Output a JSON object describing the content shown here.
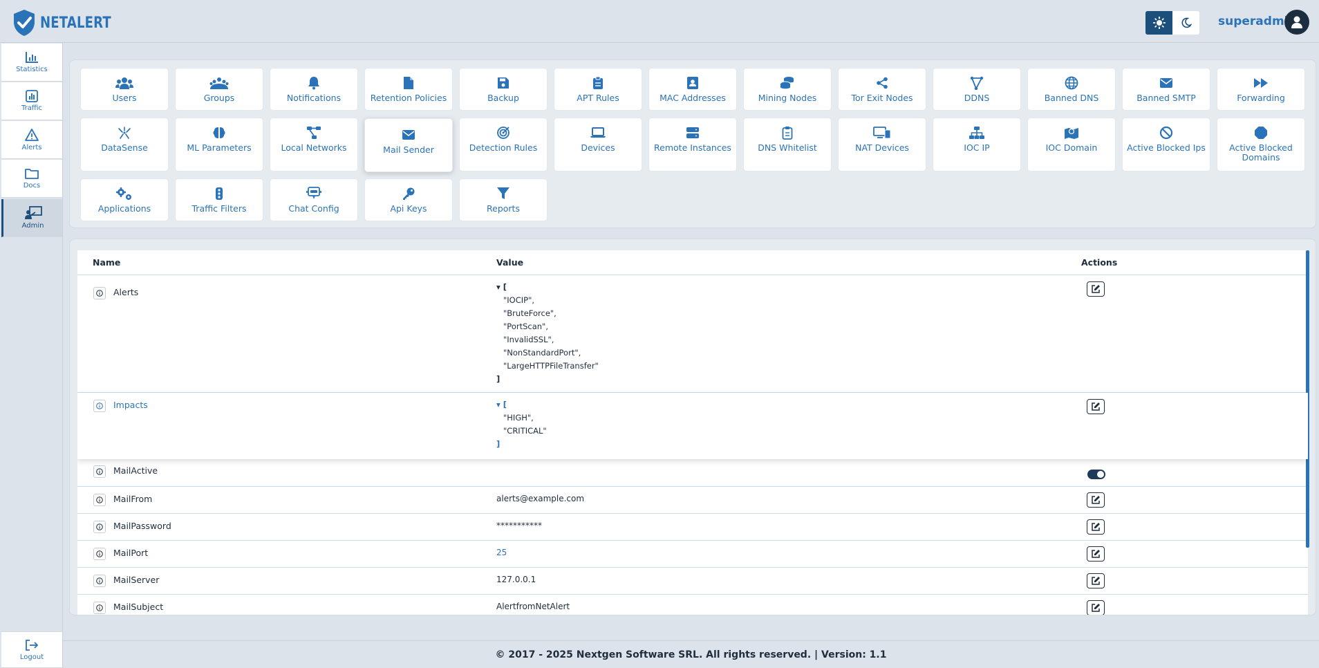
{
  "app": {
    "name": "NETALERT"
  },
  "header": {
    "username": "superadmin",
    "theme_light_icon": "sun-icon",
    "theme_dark_icon": "moon-icon"
  },
  "sidebar": {
    "items": [
      {
        "label": "Statistics",
        "icon": "bar-chart-icon"
      },
      {
        "label": "Traffic",
        "icon": "chart-square-icon"
      },
      {
        "label": "Alerts",
        "icon": "warning-triangle-icon"
      },
      {
        "label": "Docs",
        "icon": "folder-icon"
      },
      {
        "label": "Admin",
        "icon": "admin-presentation-icon",
        "active": true
      }
    ],
    "logout": "Logout"
  },
  "admin_menu": [
    {
      "label": "Users",
      "icon": "users-icon"
    },
    {
      "label": "Groups",
      "icon": "groups-icon"
    },
    {
      "label": "Notifications",
      "icon": "bell-icon"
    },
    {
      "label": "Retention Policies",
      "icon": "file-icon"
    },
    {
      "label": "Backup",
      "icon": "save-icon"
    },
    {
      "label": "APT Rules",
      "icon": "clipboard-icon"
    },
    {
      "label": "MAC Addresses",
      "icon": "address-book-icon"
    },
    {
      "label": "Mining Nodes",
      "icon": "coins-icon"
    },
    {
      "label": "Tor Exit Nodes",
      "icon": "share-icon"
    },
    {
      "label": "DDNS",
      "icon": "bezier-icon"
    },
    {
      "label": "Banned DNS",
      "icon": "globe-icon"
    },
    {
      "label": "Banned SMTP",
      "icon": "envelope-icon"
    },
    {
      "label": "Forwarding",
      "icon": "forward-icon"
    },
    {
      "label": "DataSense",
      "icon": "burst-icon"
    },
    {
      "label": "ML Parameters",
      "icon": "brain-icon"
    },
    {
      "label": "Local Networks",
      "icon": "network-icon"
    },
    {
      "label": "Mail Sender",
      "icon": "envelope-icon",
      "selected": true
    },
    {
      "label": "Detection Rules",
      "icon": "target-icon"
    },
    {
      "label": "Devices",
      "icon": "laptop-icon"
    },
    {
      "label": "Remote Instances",
      "icon": "server-icon"
    },
    {
      "label": "DNS Whitelist",
      "icon": "clipboard-check-icon"
    },
    {
      "label": "NAT Devices",
      "icon": "devices-icon"
    },
    {
      "label": "IOC IP",
      "icon": "sitemap-icon"
    },
    {
      "label": "IOC Domain",
      "icon": "map-marker-icon"
    },
    {
      "label": "Active Blocked Ips",
      "icon": "ban-icon"
    },
    {
      "label": "Active Blocked Domains",
      "icon": "octagon-icon"
    },
    {
      "label": "Applications",
      "icon": "gears-icon"
    },
    {
      "label": "Traffic Filters",
      "icon": "traffic-light-icon"
    },
    {
      "label": "Chat Config",
      "icon": "chat-icon"
    },
    {
      "label": "Api Keys",
      "icon": "key-icon"
    },
    {
      "label": "Reports",
      "icon": "filter-icon"
    }
  ],
  "table": {
    "headers": {
      "name": "Name",
      "value": "Value",
      "actions": "Actions"
    },
    "rows": [
      {
        "name": "Alerts",
        "type": "list",
        "open": "▾ [",
        "items": [
          "\"IOCIP\",",
          "\"BruteForce\",",
          "\"PortScan\",",
          "\"InvalidSSL\",",
          "\"NonStandardPort\",",
          "\"LargeHTTPFileTransfer\""
        ],
        "close": "]"
      },
      {
        "name": "Impacts",
        "type": "list",
        "open": "▾ [",
        "items": [
          "\"HIGH\",",
          "\"CRITICAL\""
        ],
        "close": "]"
      },
      {
        "name": "MailActive",
        "type": "toggle",
        "value": "",
        "enabled": true
      },
      {
        "name": "MailFrom",
        "type": "text",
        "value": "alerts@example.com"
      },
      {
        "name": "MailPassword",
        "type": "text",
        "value": "***********"
      },
      {
        "name": "MailPort",
        "type": "number",
        "value": "25"
      },
      {
        "name": "MailServer",
        "type": "text",
        "value": "127.0.0.1"
      },
      {
        "name": "MailSubject",
        "type": "text",
        "value": "AlertfromNetAlert"
      }
    ]
  },
  "footer": {
    "text": "© 2017 - 2025 Nextgen Software SRL. All rights reserved. | Version: 1.1"
  },
  "colors": {
    "accent": "#2a73b8",
    "dark": "#1d4f7c",
    "background": "#dde3ea"
  }
}
